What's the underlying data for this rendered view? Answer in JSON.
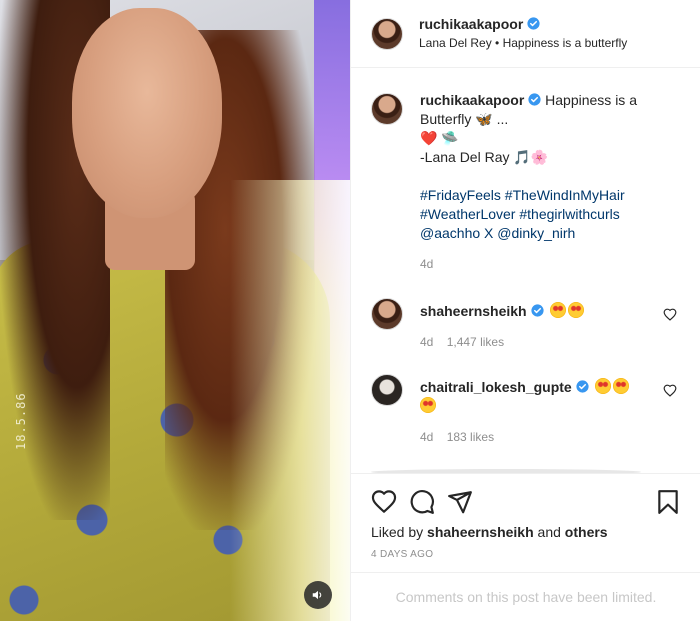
{
  "post": {
    "username": "ruchikaakapoor",
    "audio_line": "Lana Del Rey • Happiness is a butterfly",
    "media_date_stamp": "18.5.86"
  },
  "caption": {
    "username": "ruchikaakapoor",
    "text_line1": "Happiness is a",
    "text_line2": "Butterfly 🦋 ...",
    "text_line3": "❤️ 🛸",
    "text_line4": "-Lana Del Ray 🎵🌸",
    "hashtags_line1": "#FridayFeels #TheWindInMyHair",
    "hashtags_line2": "#WeatherLover #thegirlwithcurls",
    "mentions_line": "@aachho X @dinky_nirh",
    "time": "4d"
  },
  "comments": [
    {
      "username": "shaheernsheikh",
      "time": "4d",
      "likes": "1,447 likes"
    },
    {
      "username": "chaitrali_lokesh_gupte",
      "time": "4d",
      "likes": "183 likes"
    }
  ],
  "actions": {
    "liked_prefix": "Liked by",
    "liked_user": "shaheernsheikh",
    "liked_and": "and",
    "liked_others": "others",
    "posted_ago": "4 DAYS AGO"
  },
  "footer": {
    "limited_text": "Comments on this post have been limited."
  },
  "colors": {
    "link_blue": "#00376b",
    "verified_blue": "#3897f0",
    "muted_gray": "#8e8e8e"
  },
  "icons": [
    "verified-badge-icon",
    "heart-icon",
    "comment-icon",
    "share-icon",
    "bookmark-icon",
    "speaker-icon"
  ]
}
